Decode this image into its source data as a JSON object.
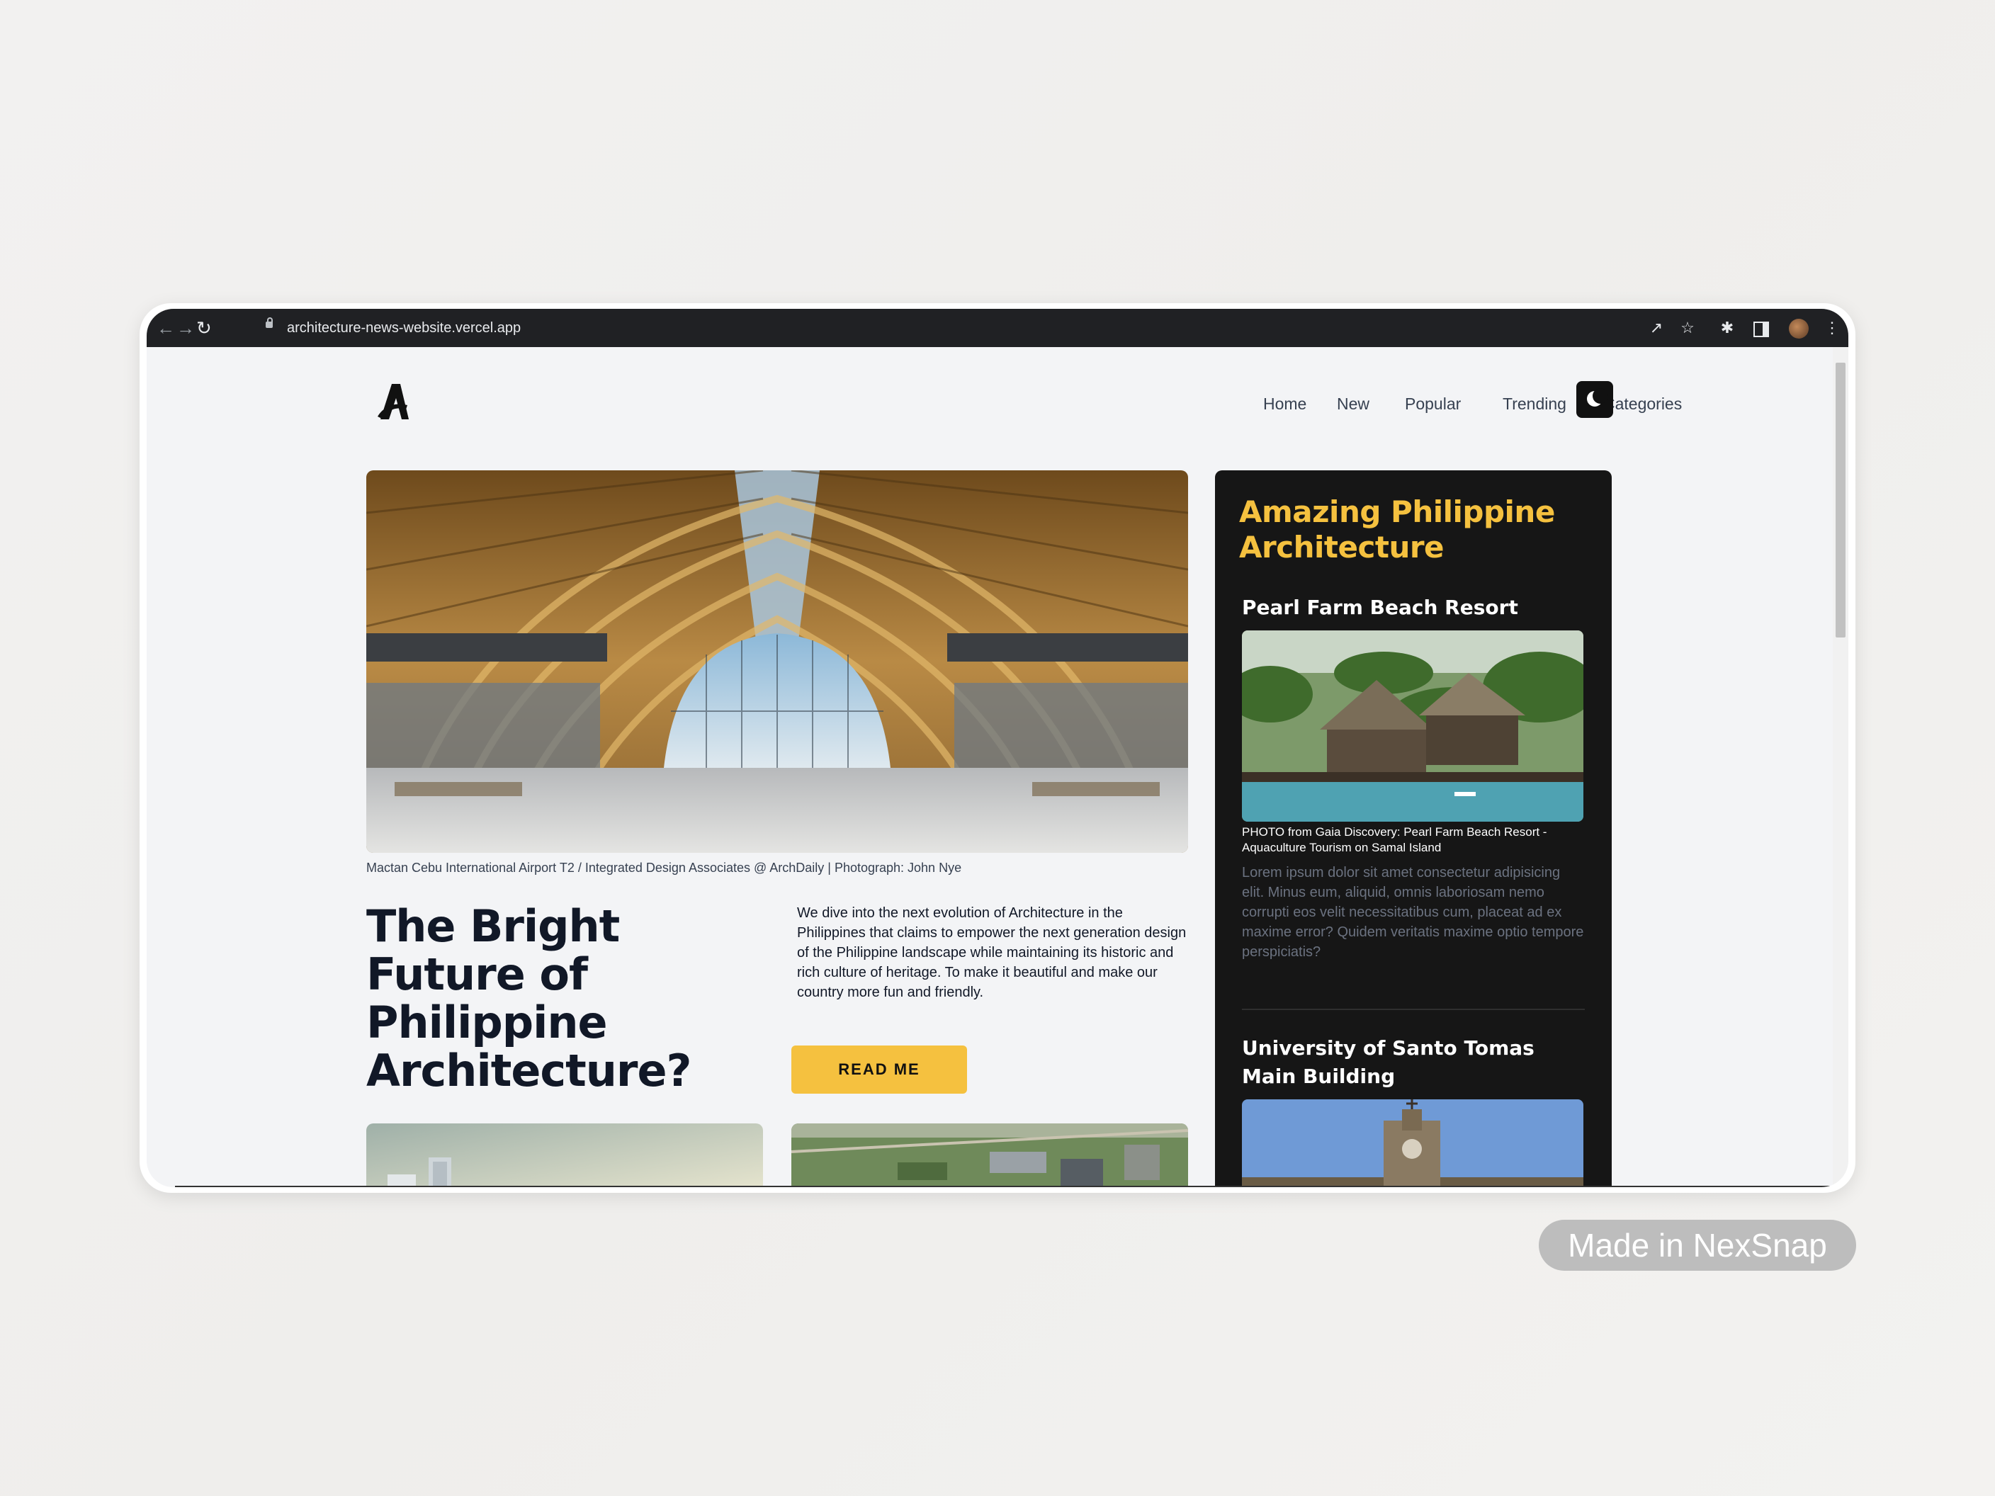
{
  "browser": {
    "url": "architecture-news-website.vercel.app"
  },
  "nav": {
    "items": [
      {
        "label": "Home"
      },
      {
        "label": "New"
      },
      {
        "label": "Popular"
      },
      {
        "label": "Trending"
      },
      {
        "label": "Categories"
      }
    ]
  },
  "hero": {
    "caption": "Mactan Cebu International Airport T2 / Integrated Design Associates @ ArchDaily | Photograph: John Nye",
    "headline": "The Bright Future of Philippine Architecture?",
    "lede": "We dive into the next evolution of Architecture in the Philippines that claims to empower the next generation design of the Philippine landscape while maintaining its historic and rich culture of heritage. To make it beautiful and make our country more fun and friendly.",
    "button_label": "READ ME"
  },
  "sidebar": {
    "title": "Amazing Philippine Architecture",
    "articles": [
      {
        "title": "Pearl Farm Beach Resort",
        "photo_caption": "PHOTO from Gaia Discovery: Pearl Farm Beach Resort - Aquaculture Tourism on Samal Island",
        "body": "Lorem ipsum dolor sit amet consectetur adipisicing elit. Minus eum, aliquid, omnis laboriosam nemo corrupti eos velit necessitatibus cum, placeat ad ex maxime error? Quidem veritatis maxime optio tempore perspiciatis?"
      },
      {
        "title": "University of Santo Tomas Main Building"
      }
    ]
  },
  "watermark": "Made in NexSnap",
  "colors": {
    "accent": "#f5c13f",
    "sidebar_bg": "#161616",
    "page_bg": "#f3f4f6",
    "browser_bar": "#202124"
  }
}
